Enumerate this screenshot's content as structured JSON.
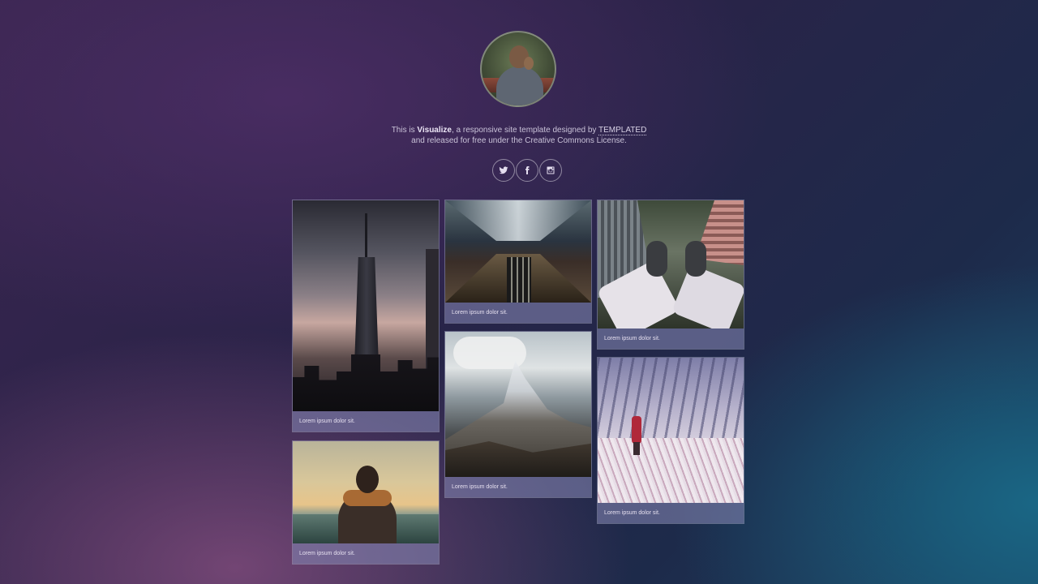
{
  "header": {
    "tagline_pre": "This is ",
    "brand": "Visualize",
    "tagline_mid": ", a responsive site template designed by ",
    "designer": "TEMPLATED",
    "tagline_line2": "and released for free under the Creative Commons License."
  },
  "socials": [
    {
      "icon": "twitter-icon"
    },
    {
      "icon": "facebook-icon"
    },
    {
      "icon": "instagram-icon"
    }
  ],
  "gallery": {
    "captions": [
      "Lorem ipsum dolor sit.",
      "Lorem ipsum dolor sit.",
      "Lorem ipsum dolor sit.",
      "Lorem ipsum dolor sit.",
      "Lorem ipsum dolor sit.",
      "Lorem ipsum dolor sit."
    ]
  }
}
